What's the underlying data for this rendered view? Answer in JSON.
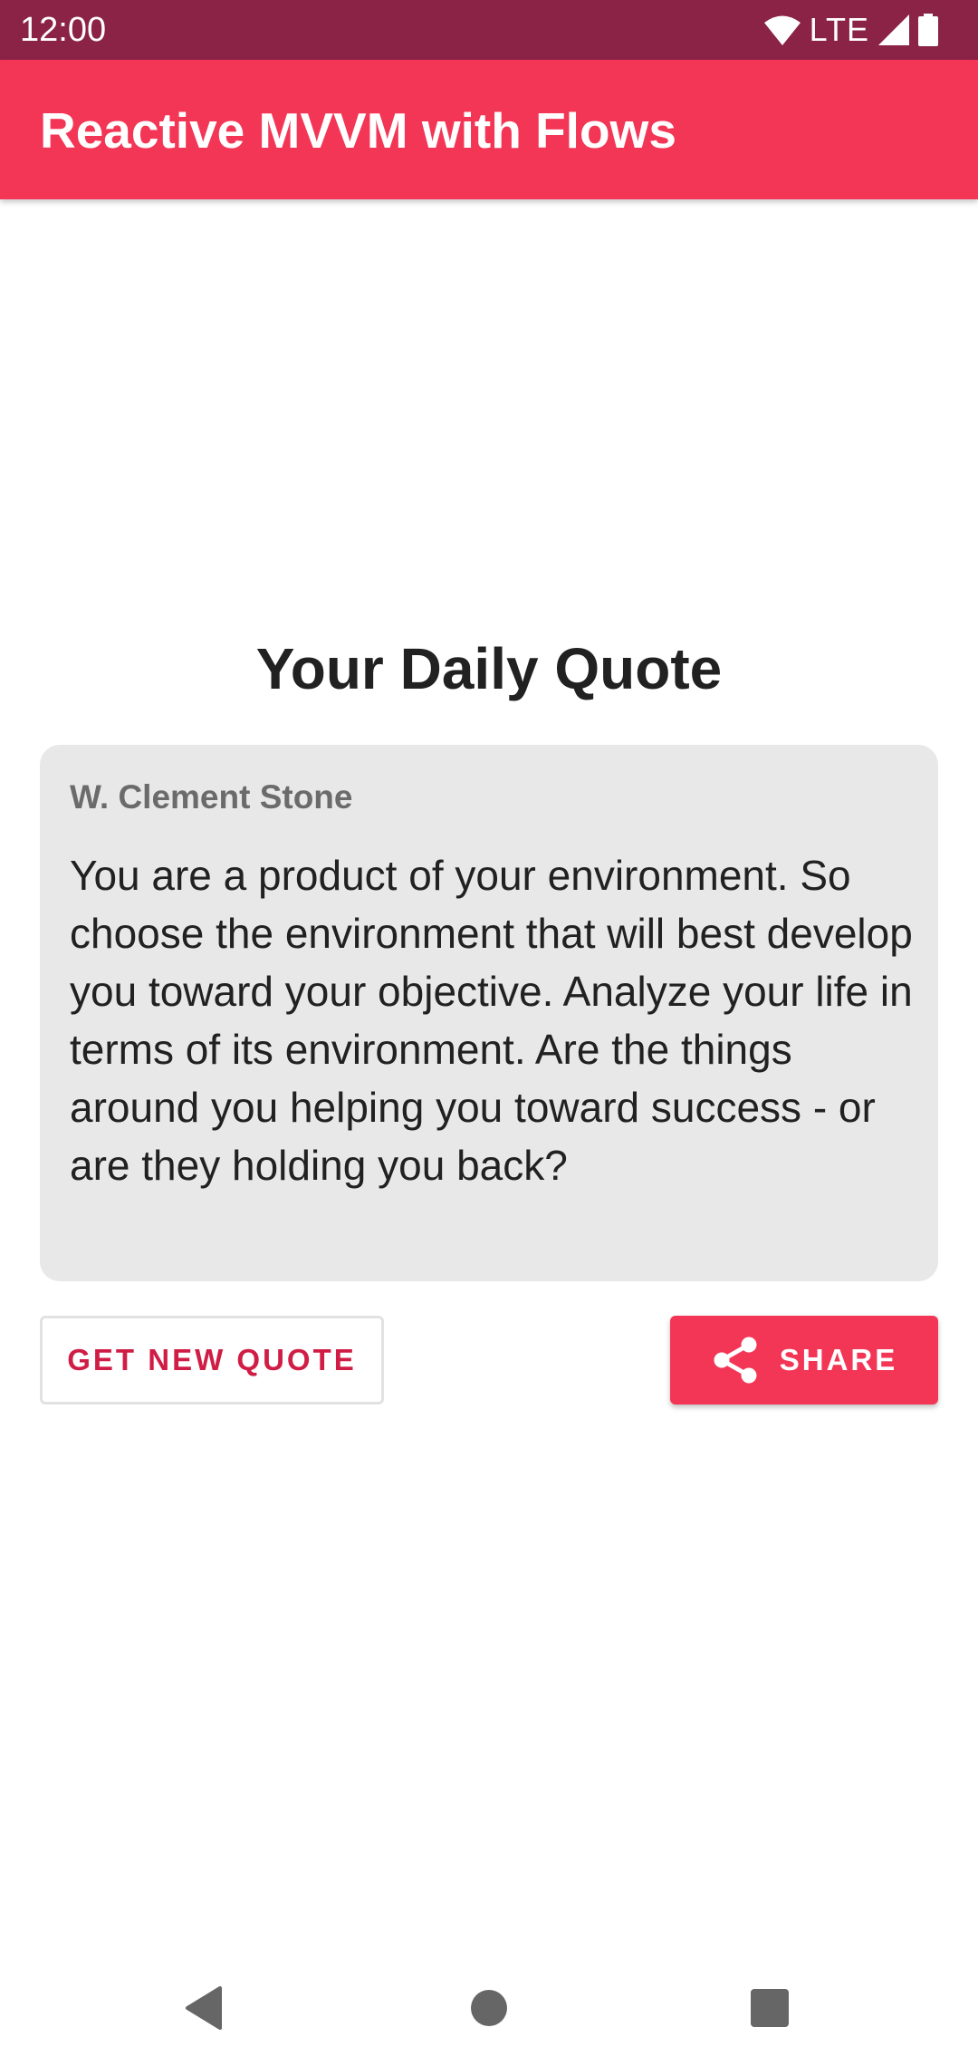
{
  "status_bar": {
    "time": "12:00",
    "network": "LTE",
    "icons": [
      "wifi-icon",
      "cell-signal-icon",
      "battery-icon"
    ]
  },
  "app_bar": {
    "title": "Reactive MVVM with Flows"
  },
  "main": {
    "heading": "Your Daily Quote",
    "quote": {
      "author": "W. Clement Stone",
      "text": "You are a product of your environment. So choose the environment that will best develop you toward your objective. Analyze your life in terms of its environment. Are the things around you helping you toward success - or are they holding you back?"
    },
    "buttons": {
      "new_quote_label": "GET NEW QUOTE",
      "share_label": "SHARE",
      "share_icon": "share-icon"
    }
  },
  "nav_bar": {
    "icons": [
      "back-icon",
      "home-icon",
      "recents-icon"
    ]
  },
  "colors": {
    "status_bar": "#8b2347",
    "primary": "#f33656",
    "accent_text": "#d01d45",
    "card_bg": "#e8e8e8"
  }
}
